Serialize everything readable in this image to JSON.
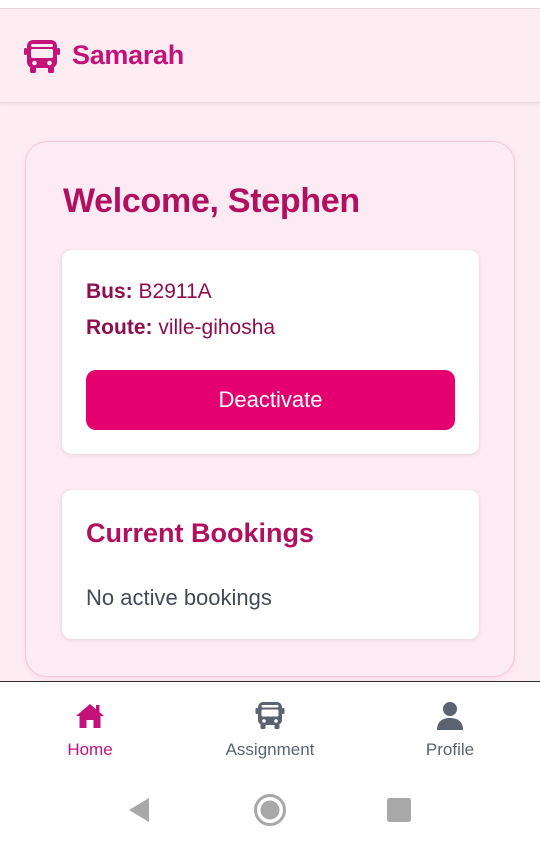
{
  "app": {
    "title": "Samarah",
    "logo_icon": "bus-icon",
    "accent": "#c3137a"
  },
  "welcome": "Welcome, Stephen",
  "bus": {
    "bus_label": "Bus:",
    "bus_value": "B2911A",
    "route_label": "Route:",
    "route_value": "ville-gihosha",
    "action_label": "Deactivate",
    "action_color": "#e5006f"
  },
  "bookings": {
    "title": "Current Bookings",
    "empty_text": "No active bookings"
  },
  "nav": {
    "items": [
      {
        "label": "Home",
        "icon": "home-icon",
        "active": true
      },
      {
        "label": "Assignment",
        "icon": "bus-icon",
        "active": false
      },
      {
        "label": "Profile",
        "icon": "person-icon",
        "active": false
      }
    ]
  },
  "system_nav": [
    "back-icon",
    "home-circle-icon",
    "recents-icon"
  ]
}
